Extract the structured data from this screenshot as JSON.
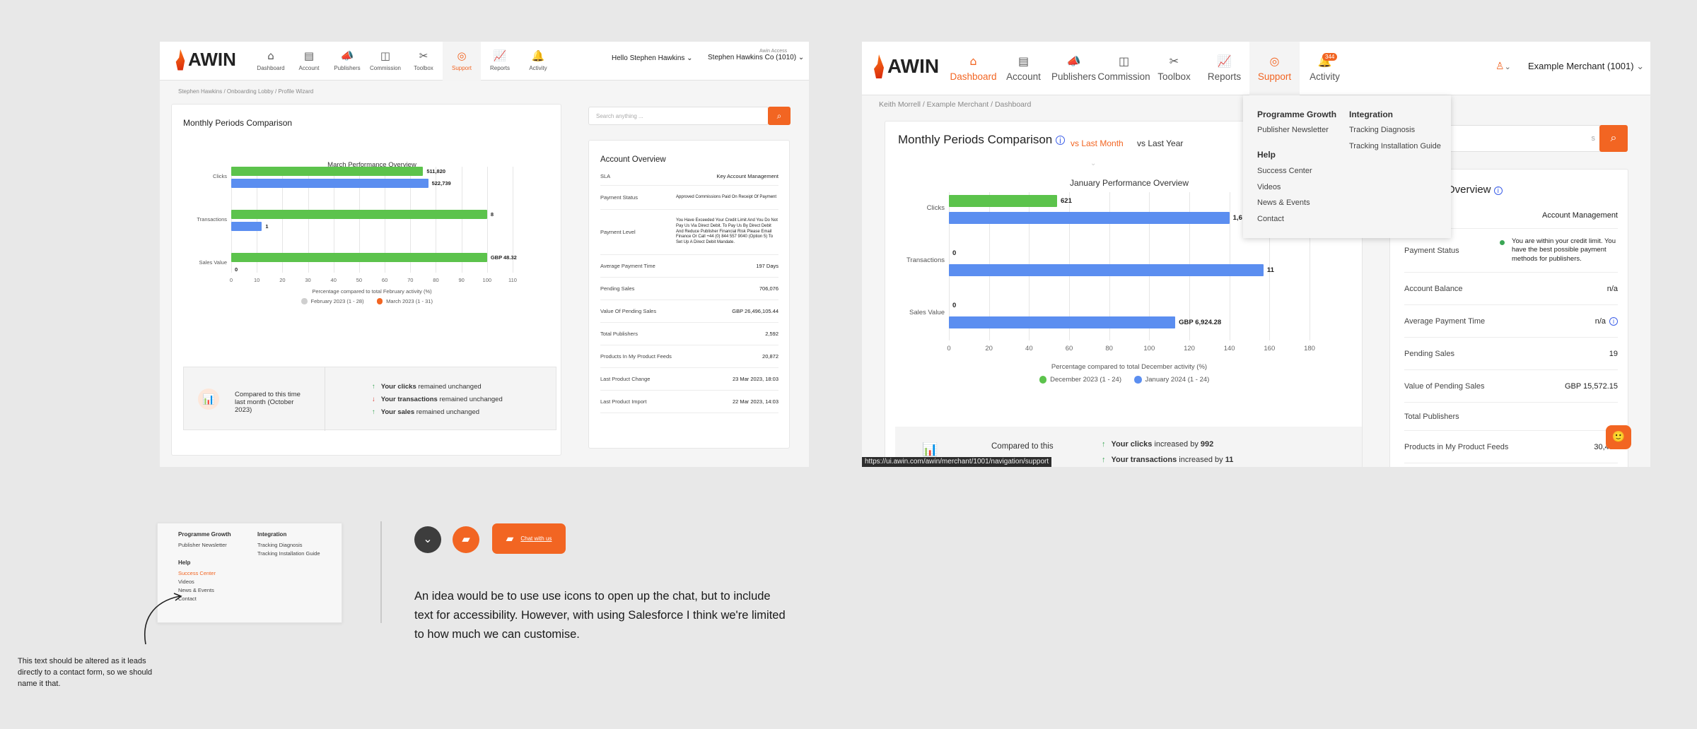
{
  "left": {
    "brand": "AWIN",
    "nav": [
      {
        "label": "Dashboard",
        "icon": "⌂"
      },
      {
        "label": "Account",
        "icon": "▤"
      },
      {
        "label": "Publishers",
        "icon": "📣"
      },
      {
        "label": "Commission",
        "icon": "◫"
      },
      {
        "label": "Toolbox",
        "icon": "✂"
      },
      {
        "label": "Support",
        "icon": "◎"
      },
      {
        "label": "Reports",
        "icon": "📈"
      },
      {
        "label": "Activity",
        "icon": "🔔"
      }
    ],
    "greeting": "Hello Stephen Hawkins",
    "access_label": "Awin Access",
    "account": "Stephen Hawkins Co (1010)",
    "breadcrumb": "Stephen Hawkins / Onboarding Lobby / Profile Wizard",
    "card_title": "Monthly Periods Comparison",
    "chart_title": "March Performance Overview",
    "xlabel": "Percentage compared to total February activity (%)",
    "legend": [
      "February 2023 (1 - 28)",
      "March 2023 (1 - 31)"
    ],
    "compare_text": "Compared to this time last month (October 2023)",
    "summary": [
      {
        "b": "Your clicks",
        "t": "remained unchanged"
      },
      {
        "b": "Your transactions",
        "t": "remained unchanged"
      },
      {
        "b": "Your sales",
        "t": "remained unchanged"
      }
    ],
    "search_placeholder": "Search anything ...",
    "overview_title": "Account Overview",
    "overview": [
      {
        "k": "SLA",
        "v": "Key Account Management"
      },
      {
        "k": "Payment Status",
        "v": "Approved Commissions Paid On Receipt Of Payment"
      },
      {
        "k": "Payment Level",
        "v": "You Have Exceeded Your Credit Limit And You Do Not Pay Us Via Direct Debit. To Pay Us By Direct Debit And Reduce Publisher Financial Risk Please Email Finance Or Call +44 (0) 844 557 9040 (Option 5) To Set Up A Direct Debit Mandate."
      },
      {
        "k": "Average Payment Time",
        "v": "197 Days"
      },
      {
        "k": "Pending Sales",
        "v": "706,076"
      },
      {
        "k": "Value Of Pending Sales",
        "v": "GBP 26,496,105.44"
      },
      {
        "k": "Total Publishers",
        "v": "2,592"
      },
      {
        "k": "Products In My Product Feeds",
        "v": "20,872"
      },
      {
        "k": "Last Product Change",
        "v": "23 Mar 2023, 18:03"
      },
      {
        "k": "Last Product Import",
        "v": "22 Mar 2023, 14:03"
      }
    ]
  },
  "chart_data": [
    {
      "type": "bar",
      "title": "March Performance Overview",
      "categories": [
        "Clicks",
        "Transactions",
        "Sales Value"
      ],
      "series": [
        {
          "name": "March 2023 (1 - 31)",
          "values": [
            75,
            100,
            100
          ],
          "labels": [
            "511,820",
            "8",
            "GBP 48.32"
          ],
          "color": "#5cc34c"
        },
        {
          "name": "February 2023 (1 - 28)",
          "values": [
            77,
            12,
            0
          ],
          "labels": [
            "522,739",
            "1",
            "0"
          ],
          "color": "#5b8ef0"
        }
      ],
      "xlabel": "Percentage compared to total February activity (%)",
      "xlim": [
        0,
        110
      ],
      "xticks": [
        0,
        10,
        20,
        30,
        40,
        50,
        60,
        70,
        80,
        90,
        100,
        110
      ]
    },
    {
      "type": "bar",
      "title": "January Performance Overview",
      "categories": [
        "Clicks",
        "Transactions",
        "Sales Value"
      ],
      "series": [
        {
          "name": "December 2023 (1 - 24)",
          "values": [
            54,
            0,
            0
          ],
          "labels": [
            "621",
            "0",
            "0"
          ],
          "color": "#5cc34c"
        },
        {
          "name": "January 2024 (1 - 24)",
          "values": [
            140,
            157,
            113
          ],
          "labels": [
            "1,6",
            "11",
            "GBP 6,924.28"
          ],
          "color": "#5b8ef0"
        }
      ],
      "xlabel": "Percentage compared to total December activity (%)",
      "xlim": [
        0,
        180
      ],
      "xticks": [
        0,
        20,
        40,
        60,
        80,
        100,
        120,
        140,
        160,
        180
      ]
    }
  ],
  "right": {
    "brand": "AWIN",
    "nav": [
      {
        "label": "Dashboard",
        "icon": "⌂"
      },
      {
        "label": "Account",
        "icon": "▤"
      },
      {
        "label": "Publishers",
        "icon": "📣"
      },
      {
        "label": "Commission",
        "icon": "◫"
      },
      {
        "label": "Toolbox",
        "icon": "✂"
      },
      {
        "label": "Reports",
        "icon": "📈"
      },
      {
        "label": "Support",
        "icon": "◎"
      },
      {
        "label": "Activity",
        "icon": "🔔"
      }
    ],
    "activity_badge": "344",
    "account": "Example Merchant (1001)",
    "breadcrumb": "Keith Morrell / Example Merchant / Dashboard",
    "card_title": "Monthly Periods Comparison",
    "tab_active": "vs Last Month",
    "tab_other": "vs Last Year",
    "chart_title": "January Performance Overview",
    "xlabel": "Percentage compared to total December activity (%)",
    "legend": [
      "December 2023 (1 - 24)",
      "January 2024 (1 - 24)"
    ],
    "compare_text": "Compared to this",
    "summary": [
      {
        "b": "Your clicks",
        "t": "increased by",
        "n": "992"
      },
      {
        "b": "Your transactions",
        "t": "increased by",
        "n": "11"
      }
    ],
    "status_url": "https://ui.awin.com/awin/merchant/1001/navigation/support",
    "overview_title": "Overview",
    "overview": [
      {
        "k": "",
        "v": "Account Management"
      },
      {
        "k": "Payment Status",
        "v": "You are within your credit limit. You have the best possible payment methods for publishers."
      },
      {
        "k": "Account Balance",
        "v": "n/a"
      },
      {
        "k": "Average Payment Time",
        "v": "n/a"
      },
      {
        "k": "Pending Sales",
        "v": "19"
      },
      {
        "k": "Value of Pending Sales",
        "v": "GBP 15,572.15"
      },
      {
        "k": "Total Publishers",
        "v": ""
      },
      {
        "k": "Products in My Product Feeds",
        "v": "30,432"
      }
    ],
    "search_tail": "s",
    "menu": {
      "col1_title": "Programme Growth",
      "col1_items": [
        "Publisher Newsletter"
      ],
      "help_title": "Help",
      "help_items": [
        "Success Center",
        "Videos",
        "News & Events",
        "Contact"
      ],
      "col2_title": "Integration",
      "col2_items": [
        "Tracking Diagnosis",
        "Tracking Installation Guide"
      ]
    }
  },
  "mini_menu": {
    "col1_title": "Programme Growth",
    "col1_items": [
      "Publisher Newsletter"
    ],
    "help_title": "Help",
    "help_items": [
      "Success Center",
      "Videos",
      "News & Events",
      "Contact"
    ],
    "col2_title": "Integration",
    "col2_items": [
      "Tracking Diagnosis",
      "Tracking Installation Guide"
    ]
  },
  "annotation": "This text should be altered as it leads directly to a contact form, so we should name it that.",
  "chat_label": "Chat with us",
  "idea_text": "An idea would be to use use icons to open up the chat, but to include text for accessibility. However, with using Salesforce I think we're limited to how much we can customise."
}
